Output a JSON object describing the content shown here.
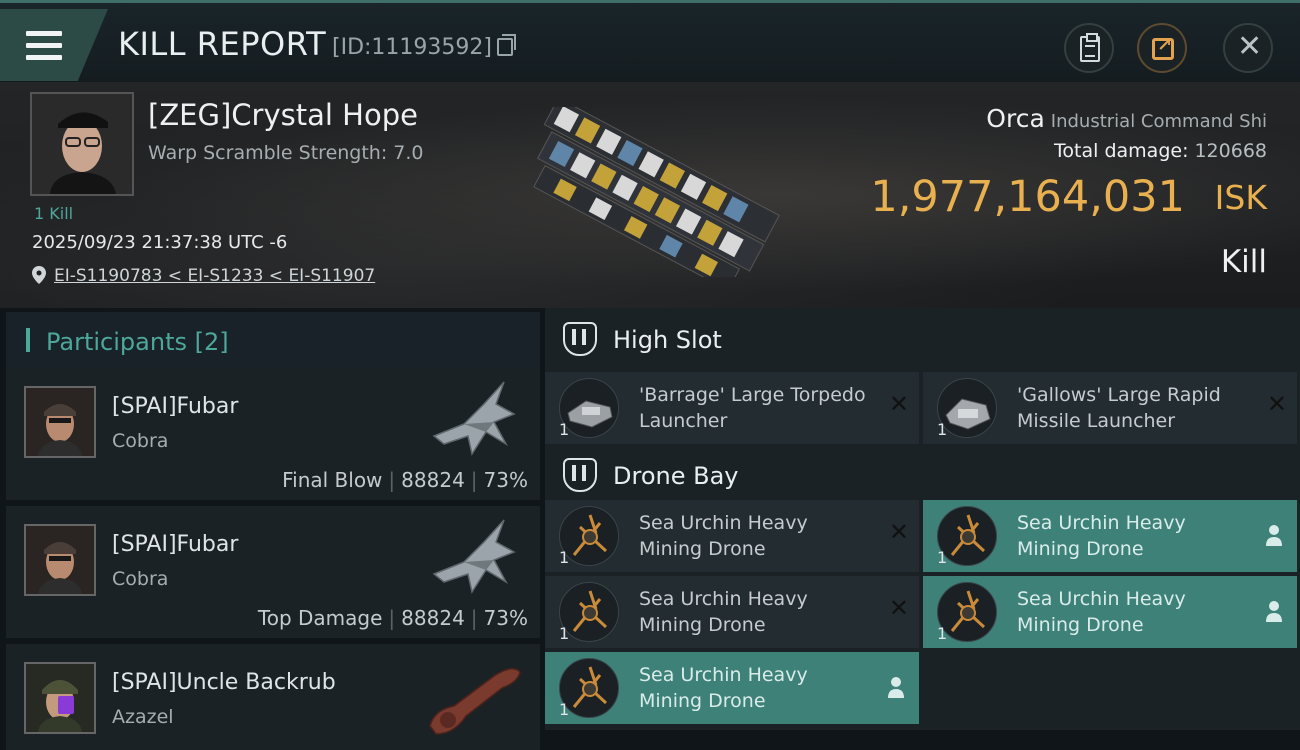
{
  "header": {
    "title": "KILL REPORT",
    "report_id": "[ID:11193592]"
  },
  "victim": {
    "name": "[ZEG]Crystal Hope",
    "warp_scramble": "Warp Scramble Strength: 7.0",
    "kills": "1 Kill",
    "timestamp": "2025/09/23 21:37:38 UTC -6",
    "location": "EI-S1190783 < EI-S1233 < EI-S11907",
    "ship": "Orca",
    "ship_class": "Industrial Command Shi",
    "total_damage_label": "Total damage:",
    "total_damage": "120668",
    "isk_value": "1,977,164,031",
    "isk_unit": "ISK",
    "result": "Kill"
  },
  "participants": {
    "title": "Participants [2]",
    "rows": [
      {
        "name": "[SPAI]Fubar",
        "ship": "Cobra",
        "role": "Final Blow",
        "damage": "88824",
        "percent": "73%"
      },
      {
        "name": "[SPAI]Fubar",
        "ship": "Cobra",
        "role": "Top Damage",
        "damage": "88824",
        "percent": "73%"
      },
      {
        "name": "[SPAI]Uncle Backrub",
        "ship": "Azazel",
        "role": "",
        "damage": "",
        "percent": ""
      }
    ]
  },
  "fitting": {
    "high_slot": {
      "title": "High Slot",
      "items": [
        {
          "qty": "1",
          "name": "'Barrage' Large Torpedo Launcher",
          "status": "destroyed"
        },
        {
          "qty": "1",
          "name": "'Gallows' Large Rapid Missile Launcher",
          "status": "destroyed"
        }
      ]
    },
    "drone_bay": {
      "title": "Drone Bay",
      "items": [
        {
          "qty": "1",
          "name": "Sea Urchin Heavy Mining Drone",
          "status": "destroyed"
        },
        {
          "qty": "1",
          "name": "Sea Urchin Heavy Mining Drone",
          "status": "dropped"
        },
        {
          "qty": "1",
          "name": "Sea Urchin Heavy Mining Drone",
          "status": "destroyed"
        },
        {
          "qty": "1",
          "name": "Sea Urchin Heavy Mining Drone",
          "status": "dropped"
        },
        {
          "qty": "1",
          "name": "Sea Urchin Heavy Mining Drone",
          "status": "dropped"
        }
      ]
    }
  },
  "colors": {
    "accent": "#4da79b",
    "isk": "#e9b04f",
    "dropped": "#3d8179"
  },
  "icons": [
    "menu-icon",
    "copy-icon",
    "clipboard-icon",
    "share-icon",
    "close-icon",
    "location-pin-icon",
    "high-slot-icon",
    "drone-bay-icon",
    "destroyed-x-icon",
    "dropped-person-icon"
  ]
}
